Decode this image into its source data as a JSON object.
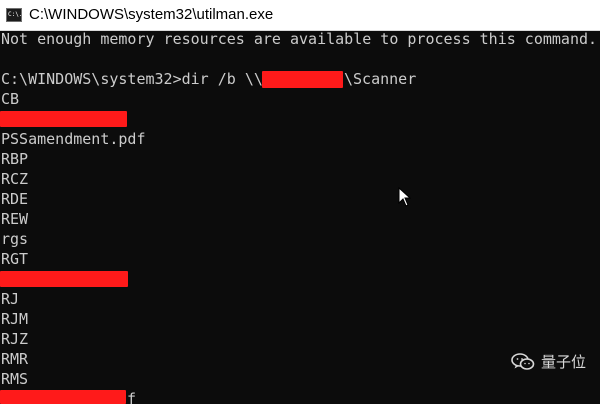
{
  "window": {
    "title": "C:\\WINDOWS\\system32\\utilman.exe",
    "icon": "cmd-console-icon",
    "icon_text": "C:\\."
  },
  "console": {
    "lines": [
      "Not enough memory resources are available to process this command.",
      "",
      "C:\\WINDOWS\\system32>dir /b \\\\",
      "CB",
      "",
      "PSSamendment.pdf",
      "RBP",
      "RCZ",
      "RDE",
      "REW",
      "rgs",
      "RGT",
      "",
      "RJ",
      "RJM",
      "RJZ",
      "RMR",
      "RMS",
      ""
    ],
    "command_suffix": "\\Scanner",
    "last_line_suffix": "f"
  },
  "colors": {
    "console_background": "#0c0c0c",
    "console_text": "#cccccc",
    "titlebar_background": "#ffffff",
    "redaction": "#ff1a1a"
  },
  "watermark": {
    "text": "量子位",
    "icon": "wechat-icon"
  },
  "icons": {
    "mouse_pointer": "mouse-pointer-icon"
  }
}
